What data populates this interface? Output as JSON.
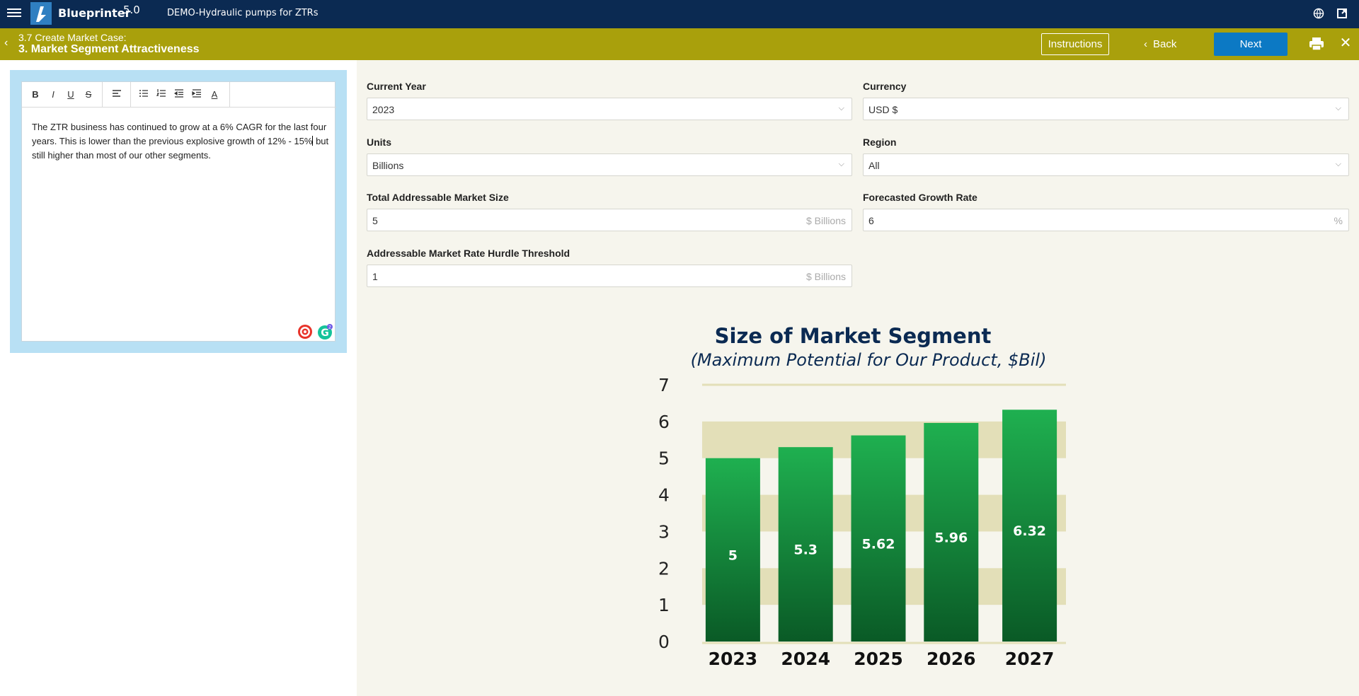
{
  "app": {
    "brand": "Blueprinter",
    "version": "5.0",
    "document_title": "DEMO-Hydraulic pumps for ZTRs"
  },
  "step": {
    "subtitle": "3.7 Create Market Case:",
    "title": "3. Market Segment Attractiveness",
    "instructions_label": "Instructions",
    "back_label": "Back",
    "next_label": "Next"
  },
  "editor": {
    "text_before_caret": "The ZTR business has continued to grow at a 6% CAGR for the last four years. This is lower than the previous explosive growth of 12% - 15%",
    "text_after_caret": " but still higher than most of our other segments.",
    "toolbar": {
      "bold": "B",
      "italic": "I",
      "underline": "U",
      "strike": "S",
      "font_color": "A"
    },
    "grammarly_badge": "2"
  },
  "form": {
    "current_year": {
      "label": "Current Year",
      "value": "2023"
    },
    "currency": {
      "label": "Currency",
      "value": "USD $"
    },
    "units": {
      "label": "Units",
      "value": "Billions"
    },
    "region": {
      "label": "Region",
      "value": "All"
    },
    "tam": {
      "label": "Total Addressable Market Size",
      "value": "5",
      "suffix": "$ Billions"
    },
    "growth": {
      "label": "Forecasted Growth Rate",
      "value": "6",
      "suffix": "%"
    },
    "hurdle": {
      "label": "Addressable Market Rate Hurdle Threshold",
      "value": "1",
      "suffix": "$ Billions"
    }
  },
  "colors": {
    "topbar": "#0b2a52",
    "stepbar": "#a9a00c",
    "next_button": "#0c79c4",
    "bar_top": "#1fb050",
    "bar_bottom": "#0a5a26",
    "grid_band": "#e3dfb8"
  },
  "chart_data": {
    "type": "bar",
    "title": "Size of Market Segment",
    "subtitle": "(Maximum Potential for Our Product, $Bil)",
    "categories": [
      "2023",
      "2024",
      "2025",
      "2026",
      "2027"
    ],
    "values": [
      5,
      5.3,
      5.62,
      5.96,
      6.32
    ],
    "data_labels": [
      "5",
      "5.3",
      "5.62",
      "5.96",
      "6.32"
    ],
    "ylim": [
      0,
      7
    ],
    "yticks": [
      "0",
      "1",
      "2",
      "3",
      "4",
      "5",
      "6",
      "7"
    ],
    "xlabel": "",
    "ylabel": "",
    "grid": true,
    "legend": "none"
  }
}
